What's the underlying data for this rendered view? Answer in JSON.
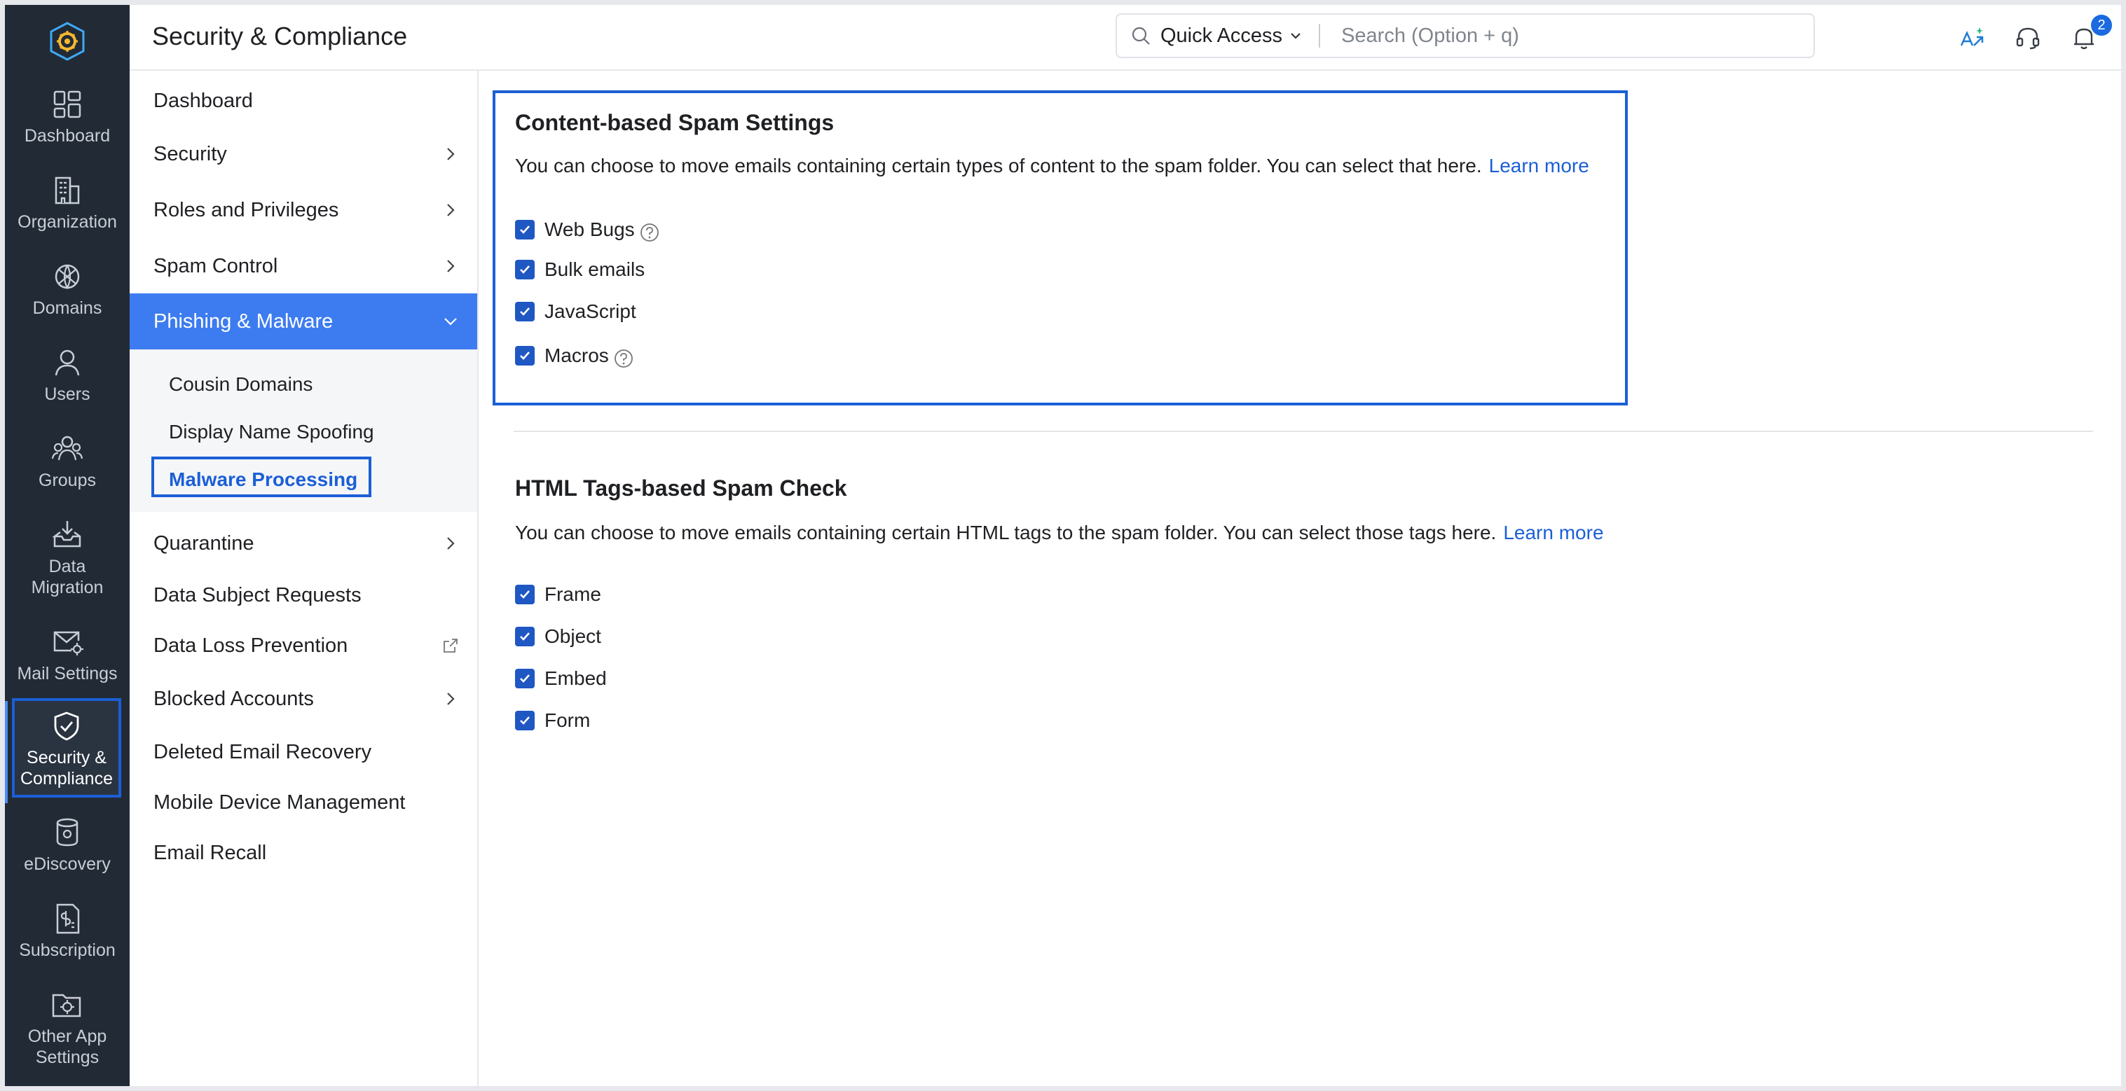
{
  "header": {
    "title": "Security & Compliance",
    "quick_access_label": "Quick Access",
    "search_placeholder": "Search (Option + q)",
    "notification_count": "2"
  },
  "rail": {
    "items": [
      {
        "label": "Dashboard",
        "icon": "dashboard-icon"
      },
      {
        "label": "Organization",
        "icon": "organization-icon"
      },
      {
        "label": "Domains",
        "icon": "domains-icon"
      },
      {
        "label": "Users",
        "icon": "user-icon"
      },
      {
        "label": "Groups",
        "icon": "groups-icon"
      },
      {
        "label": "Data Migration",
        "icon": "data-migration-icon"
      },
      {
        "label": "Mail Settings",
        "icon": "mail-settings-icon"
      },
      {
        "label": "Security & Compliance",
        "icon": "shield-check-icon"
      },
      {
        "label": "eDiscovery",
        "icon": "ediscovery-icon"
      },
      {
        "label": "Subscription",
        "icon": "subscription-icon"
      },
      {
        "label": "Other App Settings",
        "icon": "other-app-settings-icon"
      }
    ]
  },
  "nav": {
    "items": {
      "dashboard": "Dashboard",
      "security": "Security",
      "roles": "Roles and Privileges",
      "spam": "Spam Control",
      "phishing": "Phishing & Malware",
      "quarantine": "Quarantine",
      "dsr": "Data Subject Requests",
      "dlp": "Data Loss Prevention",
      "blocked": "Blocked Accounts",
      "deleted": "Deleted Email Recovery",
      "mdm": "Mobile Device Management",
      "recall": "Email Recall"
    },
    "sub": {
      "cousin": "Cousin Domains",
      "display": "Display Name Spoofing",
      "malware": "Malware Processing"
    }
  },
  "content": {
    "section1": {
      "title": "Content-based Spam Settings",
      "desc": "You can choose to move emails containing certain types of content to the spam folder. You can select that here.",
      "learn_more": "Learn more",
      "options": [
        "Web Bugs",
        "Bulk emails",
        "JavaScript",
        "Macros"
      ]
    },
    "section2": {
      "title": "HTML Tags-based Spam Check",
      "desc": "You can choose to move emails containing certain HTML tags to the spam folder. You can select those tags here.",
      "learn_more": "Learn more",
      "options": [
        "Frame",
        "Object",
        "Embed",
        "Form"
      ]
    }
  },
  "colors": {
    "accent": "#3d7cf0",
    "highlight_border": "#1b5fd6",
    "rail_bg": "#222a35",
    "checkbox": "#1f57c3"
  }
}
